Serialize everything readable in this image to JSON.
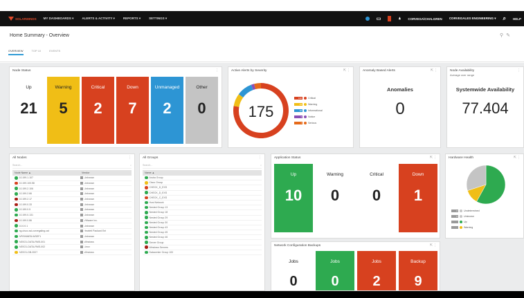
{
  "nav": {
    "brand": "SOLARWINDS",
    "items": [
      "MY DASHBOARDS ▾",
      "ALERTS & ACTIVITY ▾",
      "REPORTS ▾",
      "SETTINGS ▾"
    ],
    "user": "CORVEGA\\CHALGREN",
    "org": "CORVEGALES ENGINEERING ▾",
    "help": "HELP"
  },
  "page": {
    "title": "Home Summary - Overview",
    "tabs": [
      "OVERVIEW",
      "TOP 10",
      "EVENTS"
    ]
  },
  "colors": {
    "green": "#2eaa50",
    "yellow": "#f0be16",
    "red": "#d7411f",
    "blue": "#1f86c8",
    "grey": "#c4c4c4",
    "orange": "#e56a1a",
    "purple": "#8a4fb5",
    "darkred": "#a81d15"
  },
  "node_status": {
    "title": "Node Status",
    "tiles": [
      {
        "label": "Up",
        "value": "21",
        "color": "#ffffff",
        "text": "#222"
      },
      {
        "label": "Warning",
        "value": "5",
        "color": "#f0be16",
        "text": "#222"
      },
      {
        "label": "Critical",
        "value": "2",
        "color": "#d7411f",
        "text": "#fff"
      },
      {
        "label": "Down",
        "value": "7",
        "color": "#d7411f",
        "text": "#fff"
      },
      {
        "label": "Unmanaged",
        "value": "2",
        "color": "#2d95d4",
        "text": "#fff"
      },
      {
        "label": "Other",
        "value": "0",
        "color": "#c4c4c4",
        "text": "#222"
      }
    ]
  },
  "active_alerts": {
    "title": "Active Alerts by Severity",
    "total": "175",
    "legend": [
      {
        "label": "Critical",
        "count": "136",
        "color": "#d7411f"
      },
      {
        "label": "Warning",
        "count": "13",
        "color": "#f0be16"
      },
      {
        "label": "Informational",
        "count": "16",
        "color": "#2d95d4"
      },
      {
        "label": "Notice",
        "count": "3",
        "color": "#8a4fb5"
      },
      {
        "label": "Serious",
        "count": "7",
        "color": "#e56a1a"
      }
    ]
  },
  "anomaly": {
    "title": "Anomaly Based Alerts",
    "label": "Anomalies",
    "value": "0"
  },
  "availability": {
    "title": "Node Availability",
    "subtitle": "Average over range",
    "label": "Systemwide Availability",
    "value": "77.404"
  },
  "all_nodes": {
    "title": "All Nodes",
    "search": "Search...",
    "columns": [
      "Node Name ▲",
      "Vendor"
    ],
    "rows": [
      {
        "name": "10.199.1.107",
        "vendor": "Unknown",
        "status": "#2eaa50"
      },
      {
        "name": "10.199.100.58",
        "vendor": "Unknown",
        "status": "#d7411f"
      },
      {
        "name": "10.199.2.106",
        "vendor": "Unknown",
        "status": "#2eaa50"
      },
      {
        "name": "10.199.2.66",
        "vendor": "Unknown",
        "status": "#2eaa50"
      },
      {
        "name": "10.199.2.17",
        "vendor": "Unknown",
        "status": "#a81d15"
      },
      {
        "name": "10.199.0.33",
        "vendor": "Unknown",
        "status": "#a81d15"
      },
      {
        "name": "10.199.0.5",
        "vendor": "Unknown",
        "status": "#2eaa50"
      },
      {
        "name": "10.199.0.131",
        "vendor": "Unknown",
        "status": "#2eaa50"
      },
      {
        "name": "10.199.0.86",
        "vendor": "VMware Inc.",
        "status": "#a81d15"
      },
      {
        "name": "10.0.0.1",
        "vendor": "Unknown",
        "status": "#2eaa50"
      },
      {
        "name": "ag-cisco-ssl-corvegaling.cat",
        "vendor": "Hewlett Packard Ent",
        "status": "#2eaa50"
      },
      {
        "name": "APISNWEB-WSEF1",
        "vendor": "Unknown",
        "status": "#2eaa50"
      },
      {
        "name": "ASSO1-DATA-RMS-001",
        "vendor": "Windows",
        "status": "#2eaa50"
      },
      {
        "name": "ASSO1-DATA-RMS-002",
        "vendor": "Linux",
        "status": "#2eaa50"
      },
      {
        "name": "ASSO1-DB-2007",
        "vendor": "Windows",
        "status": "#f0be16"
      }
    ]
  },
  "all_groups": {
    "title": "All Groups",
    "search": "Search...",
    "columns": [
      "Name ▲"
    ],
    "rows": [
      {
        "name": "Aruba Group",
        "status": "#2eaa50"
      },
      {
        "name": "Cisco Group",
        "status": "#f0be16"
      },
      {
        "name": "CHECK_D_EXS",
        "status": "#d7411f"
      },
      {
        "name": "CHECK_D_EXS",
        "status": "#2eaa50"
      },
      {
        "name": "CHECK_C_EXS",
        "status": "#d7411f"
      },
      {
        "name": "Host Network",
        "status": "#2eaa50"
      },
      {
        "name": "Nested Group 13",
        "status": "#2eaa50"
      },
      {
        "name": "Nested Group 18",
        "status": "#2eaa50"
      },
      {
        "name": "Nested Group 29",
        "status": "#2eaa50"
      },
      {
        "name": "Nested Group 30",
        "status": "#2eaa50"
      },
      {
        "name": "Nested Group 43",
        "status": "#2eaa50"
      },
      {
        "name": "Nested Group 45",
        "status": "#2eaa50"
      },
      {
        "name": "Nested Group 46",
        "status": "#2eaa50"
      },
      {
        "name": "Server Group",
        "status": "#2eaa50"
      },
      {
        "name": "Windows Servers",
        "status": "#a81d15"
      },
      {
        "name": "Datacenter Group 100",
        "status": "#2eaa50"
      }
    ]
  },
  "app_status": {
    "title": "Application Status",
    "tiles": [
      {
        "label": "Up",
        "value": "10",
        "color": "#2eaa50",
        "text": "#fff"
      },
      {
        "label": "Warning",
        "value": "0",
        "color": "#ffffff",
        "text": "#222"
      },
      {
        "label": "Critical",
        "value": "0",
        "color": "#ffffff",
        "text": "#222"
      },
      {
        "label": "Down",
        "value": "1",
        "color": "#d7411f",
        "text": "#fff"
      }
    ]
  },
  "ncm": {
    "title": "Network Configuration Backups",
    "tiles": [
      {
        "label": "Jobs",
        "value": "0",
        "color": "#ffffff",
        "text": "#222"
      },
      {
        "label": "Jobs",
        "value": "0",
        "color": "#2eaa50",
        "text": "#fff"
      },
      {
        "label": "Jobs",
        "value": "2",
        "color": "#d7411f",
        "text": "#fff"
      },
      {
        "label": "Backup",
        "value": "9",
        "color": "#d7411f",
        "text": "#fff"
      }
    ]
  },
  "hardware": {
    "title": "Hardware Health",
    "legend": [
      {
        "label": "Undetermined",
        "count": "0",
        "color": "#c4c4c4"
      },
      {
        "label": "Unknown",
        "count": "0",
        "color": "#c4c4c4"
      },
      {
        "label": "Up",
        "count": "",
        "color": "#2eaa50"
      },
      {
        "label": "Warning",
        "count": "",
        "color": "#f0be16"
      }
    ]
  }
}
